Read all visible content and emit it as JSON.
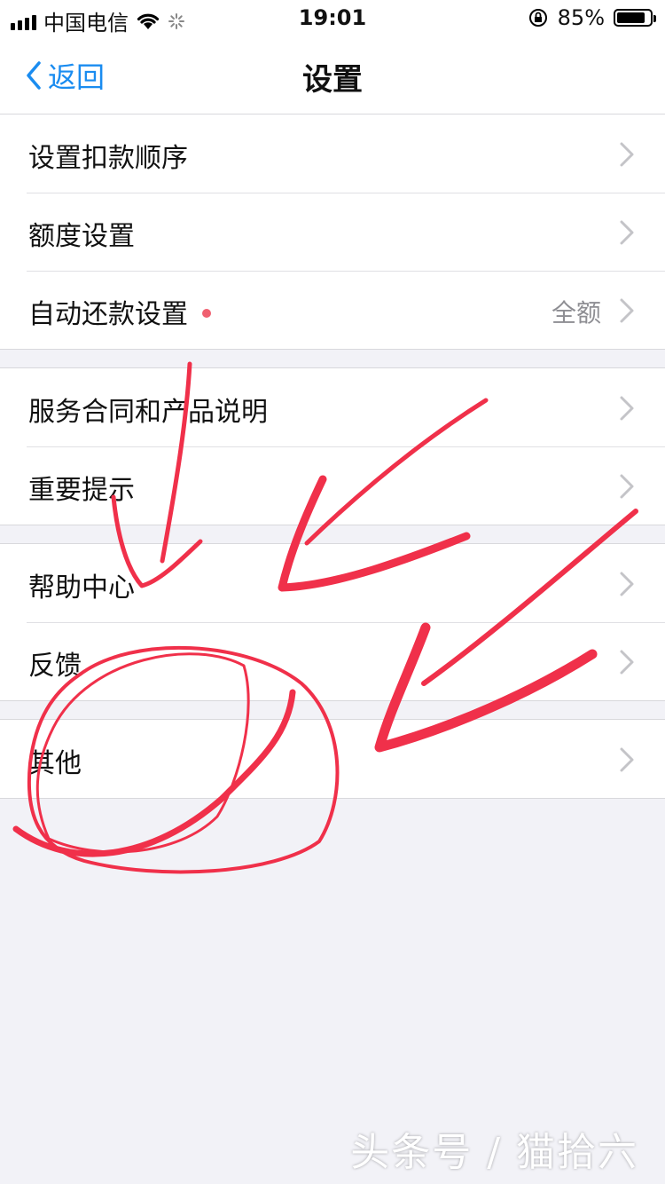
{
  "status_bar": {
    "carrier": "中国电信",
    "time": "19:01",
    "battery": "85%",
    "battery_level": 0.85
  },
  "nav": {
    "back_label": "返回",
    "title": "设置"
  },
  "groups": [
    {
      "rows": [
        {
          "label": "设置扣款顺序"
        },
        {
          "label": "额度设置"
        },
        {
          "label": "自动还款设置",
          "value": "全额",
          "badge": "red-dot"
        }
      ]
    },
    {
      "rows": [
        {
          "label": "服务合同和产品说明"
        },
        {
          "label": "重要提示"
        }
      ]
    },
    {
      "rows": [
        {
          "label": "帮助中心"
        },
        {
          "label": "反馈"
        }
      ]
    },
    {
      "rows": [
        {
          "label": "其他"
        }
      ]
    }
  ],
  "watermark": "头条号 / 猫拾六",
  "colors": {
    "accent": "#1a8cf0",
    "annotation": "#f0304a",
    "background": "#f2f2f7"
  }
}
